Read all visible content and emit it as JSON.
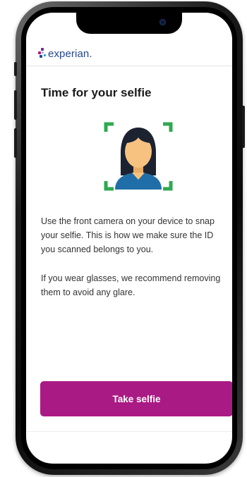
{
  "brand": {
    "name": "experian.",
    "colors": {
      "text": "#26478d",
      "dots": [
        "#6c2a8c",
        "#aa1a84",
        "#26478d",
        "#1b9dd9",
        "#b3b3d6"
      ]
    }
  },
  "screen": {
    "title": "Time for your selfie",
    "illustration_icon": "selfie-face-frame-icon",
    "paragraphs": [
      "Use the front camera on your device to snap your selfie. This is how we make sure the ID you scanned belongs to you.",
      "If you wear glasses, we recommend removing them to avoid any glare."
    ],
    "primary_button": "Take selfie"
  },
  "colors": {
    "accent": "#aa1a84",
    "frame_corners": "#2fa84f",
    "skin": "#f7c27f",
    "hair": "#1c2230",
    "shirt": "#1f6ea8"
  }
}
